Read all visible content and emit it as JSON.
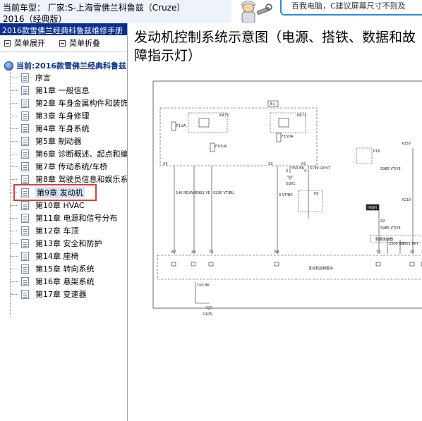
{
  "header": {
    "vehicle_label": "当前车型： 厂家:S-上海雪佛兰科鲁兹（Cruze）",
    "vehicle_line2": "2016（经典版）",
    "banner_text": "百我电脑，C建议屏幕尺寸不则及"
  },
  "left_panel": {
    "title": "2016款雪佛兰经典科鲁兹维修手册",
    "toolbar": {
      "expand_label": "菜单展开",
      "collapse_label": "菜单折叠"
    },
    "tree_root": "当前:2016款雪佛兰经典科鲁兹",
    "items": [
      {
        "label": "序言"
      },
      {
        "label": "第1章 一般信息"
      },
      {
        "label": "第2章 车身金属构件和装饰"
      },
      {
        "label": "第3章 车身修理"
      },
      {
        "label": "第4章 车身系统"
      },
      {
        "label": "第5章 制动器"
      },
      {
        "label": "第6章 诊断概述、起点和编"
      },
      {
        "label": "第7章 传动系统/车桥"
      },
      {
        "label": "第8章 驾驶员信息和娱乐系"
      },
      {
        "label": "第9章 发动机",
        "selected": true
      },
      {
        "label": "第10章 HVAC"
      },
      {
        "label": "第11章 电源和信号分布"
      },
      {
        "label": "第12章 车顶"
      },
      {
        "label": "第13章 安全和防护"
      },
      {
        "label": "第14章 座椅"
      },
      {
        "label": "第15章 转向系统"
      },
      {
        "label": "第16章 悬架系统"
      },
      {
        "label": "第17章 变速器"
      }
    ]
  },
  "content": {
    "title": "发动机控制系统示意图（电源、搭铁、数据和故障指示灯）"
  },
  "diagram_labels": {
    "bplus": "B+",
    "kr73": "KR73",
    "kr71": "KR71",
    "f10ua": "F10UA",
    "f1ua": "F1UA",
    "f15ua": "F15UA",
    "high": "HIGH",
    "x3": "X3",
    "x2": "X2",
    "x1": "X1",
    "x250": "X250",
    "x110": "X110",
    "g301": "G301",
    "g105": "G105",
    "w146": "146 RD/WH",
    "w5991": "5991 YE",
    "w5290": "5290 VT/BU",
    "w3": "3 VT/BK",
    "w5199": "5199 GY/VT",
    "w550": "550 BK",
    "w5985": "5985 VT/YE",
    "w2500": "2500 BU",
    "w2501": "2501 WH",
    "w150": "150 BK",
    "mod_ecm": "发动机控制模块",
    "a2": "A2",
    "k9": "K9",
    "dlc": "数据连接器",
    "p16": "P16",
    "pin_numbers": [
      "67",
      "44",
      "75",
      "68",
      "3",
      "4",
      "72",
      "20",
      "21"
    ]
  },
  "colors": {
    "title_bar": "#0a2f8f",
    "highlight": "#e23b3b",
    "banner_border": "#2a89d6"
  }
}
